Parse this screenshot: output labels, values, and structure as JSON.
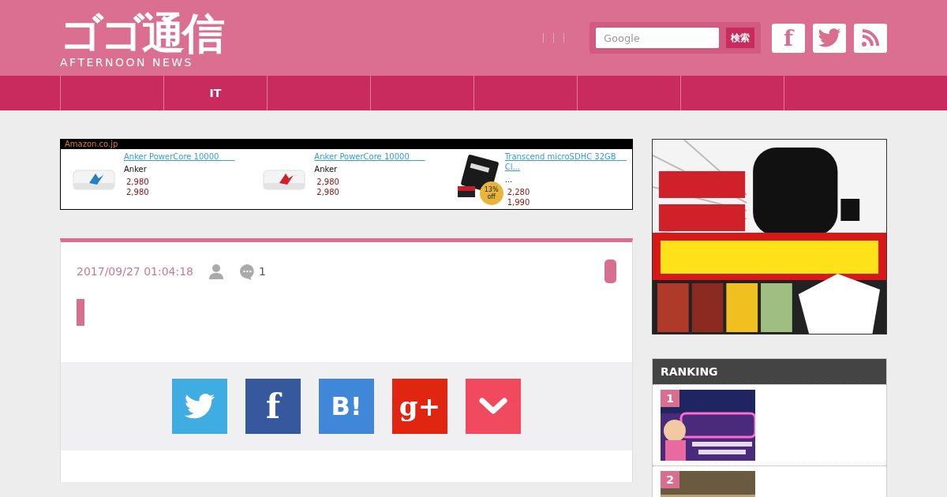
{
  "header": {
    "logo": {
      "title": "ゴゴ通信",
      "subtitle": "AFTERNOON NEWS"
    },
    "search": {
      "placeholder": "Google",
      "button": "検索"
    },
    "social": [
      {
        "kind": "facebook",
        "label": "f"
      },
      {
        "kind": "twitter"
      },
      {
        "kind": "rss"
      }
    ]
  },
  "nav": {
    "items": [
      {
        "label": "IT"
      }
    ]
  },
  "amazon": {
    "label": "Amazon.co.jp",
    "products": [
      {
        "title": "Anker PowerCore  10000　　",
        "brand": "Anker",
        "price": "2,980",
        "sale_price": "2,980"
      },
      {
        "title": "Anker PowerCore  10000　　",
        "brand": "Anker",
        "price": "2,980",
        "sale_price": "2,980"
      },
      {
        "title": "Transcend microSDHC 32GB　 Cl...",
        "brand": "...",
        "price": "2,280",
        "sale_price": "1,990",
        "badge": {
          "percent": "13%",
          "word": "off"
        }
      }
    ]
  },
  "post": {
    "date": "2017/09/27 01:04:18",
    "comments": "1",
    "share": [
      {
        "kind": "twitter"
      },
      {
        "kind": "facebook",
        "label": "f"
      },
      {
        "kind": "hatena",
        "label": "B!"
      },
      {
        "kind": "google",
        "label": "g+"
      },
      {
        "kind": "pocket"
      }
    ]
  },
  "sidebar": {
    "ranking": {
      "title": "RANKING",
      "items": [
        {
          "rank": "1",
          "kind": "picture"
        },
        {
          "rank": "2",
          "kind": "picture"
        }
      ]
    }
  }
}
